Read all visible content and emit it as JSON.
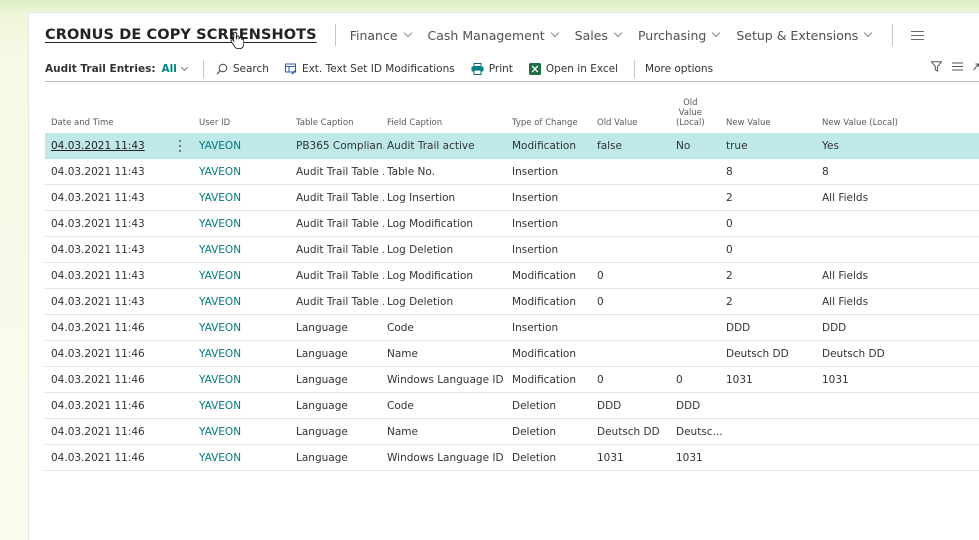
{
  "nav": {
    "company": "CRONUS DE COPY SCREENSHOTS",
    "menus": [
      "Finance",
      "Cash Management",
      "Sales",
      "Purchasing",
      "Setup & Extensions"
    ]
  },
  "actionbar": {
    "title": "Audit Trail Entries:",
    "filter": "All",
    "search": "Search",
    "ext_text": "Ext. Text Set ID Modifications",
    "print": "Print",
    "open_excel": "Open in Excel",
    "more": "More options"
  },
  "table": {
    "headers": {
      "date": "Date and Time",
      "user": "User ID",
      "table_caption": "Table Caption",
      "field_caption": "Field Caption",
      "type": "Type of Change",
      "old_value": "Old Value",
      "old_local_1": "Old",
      "old_local_2": "Value",
      "old_local_3": "(Local)",
      "new_value": "New Value",
      "new_local": "New Value (Local)"
    },
    "rows": [
      {
        "date": "04.03.2021 11:43",
        "user": "YAVEON",
        "table": "PB365 Complian...",
        "field": "Audit Trail active",
        "type": "Modification",
        "old": "false",
        "old_local": "No",
        "new": "true",
        "new_local": "Yes"
      },
      {
        "date": "04.03.2021 11:43",
        "user": "YAVEON",
        "table": "Audit Trail Table ...",
        "field": "Table No.",
        "type": "Insertion",
        "old": "",
        "old_local": "",
        "new": "8",
        "new_local": "8"
      },
      {
        "date": "04.03.2021 11:43",
        "user": "YAVEON",
        "table": "Audit Trail Table ...",
        "field": "Log Insertion",
        "type": "Insertion",
        "old": "",
        "old_local": "",
        "new": "2",
        "new_local": "All Fields"
      },
      {
        "date": "04.03.2021 11:43",
        "user": "YAVEON",
        "table": "Audit Trail Table ...",
        "field": "Log Modification",
        "type": "Insertion",
        "old": "",
        "old_local": "",
        "new": "0",
        "new_local": ""
      },
      {
        "date": "04.03.2021 11:43",
        "user": "YAVEON",
        "table": "Audit Trail Table ...",
        "field": "Log Deletion",
        "type": "Insertion",
        "old": "",
        "old_local": "",
        "new": "0",
        "new_local": ""
      },
      {
        "date": "04.03.2021 11:43",
        "user": "YAVEON",
        "table": "Audit Trail Table ...",
        "field": "Log Modification",
        "type": "Modification",
        "old": "0",
        "old_local": "",
        "new": "2",
        "new_local": "All Fields"
      },
      {
        "date": "04.03.2021 11:43",
        "user": "YAVEON",
        "table": "Audit Trail Table ...",
        "field": "Log Deletion",
        "type": "Modification",
        "old": "0",
        "old_local": "",
        "new": "2",
        "new_local": "All Fields"
      },
      {
        "date": "04.03.2021 11:46",
        "user": "YAVEON",
        "table": "Language",
        "field": "Code",
        "type": "Insertion",
        "old": "",
        "old_local": "",
        "new": "DDD",
        "new_local": "DDD"
      },
      {
        "date": "04.03.2021 11:46",
        "user": "YAVEON",
        "table": "Language",
        "field": "Name",
        "type": "Modification",
        "old": "",
        "old_local": "",
        "new": "Deutsch DD",
        "new_local": "Deutsch DD"
      },
      {
        "date": "04.03.2021 11:46",
        "user": "YAVEON",
        "table": "Language",
        "field": "Windows Language ID",
        "type": "Modification",
        "old": "0",
        "old_local": "0",
        "new": "1031",
        "new_local": "1031"
      },
      {
        "date": "04.03.2021 11:46",
        "user": "YAVEON",
        "table": "Language",
        "field": "Code",
        "type": "Deletion",
        "old": "DDD",
        "old_local": "DDD",
        "new": "",
        "new_local": ""
      },
      {
        "date": "04.03.2021 11:46",
        "user": "YAVEON",
        "table": "Language",
        "field": "Name",
        "type": "Deletion",
        "old": "Deutsch DD",
        "old_local": "Deutsc...",
        "new": "",
        "new_local": ""
      },
      {
        "date": "04.03.2021 11:46",
        "user": "YAVEON",
        "table": "Language",
        "field": "Windows Language ID",
        "type": "Deletion",
        "old": "1031",
        "old_local": "1031",
        "new": "",
        "new_local": ""
      }
    ]
  },
  "colors": {
    "accent": "#008489",
    "selected_row": "#bfe8e8",
    "excel_green": "#1d7044"
  }
}
